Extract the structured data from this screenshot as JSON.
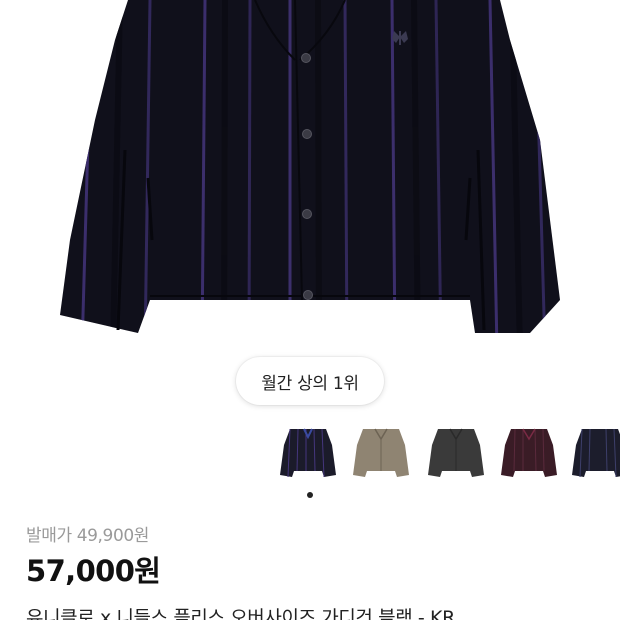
{
  "product": {
    "rank_badge": "월간 상의 1위",
    "original_price": "발매가 49,900원",
    "price": "57,000원",
    "title": "유니클로 x 니들스 플리스 오버사이즈 가디건 블랙 - KR"
  },
  "colors": {
    "jacket_base": "#13131f",
    "stripe_purple": "#4b3a86",
    "stripe_dark": "#0a0a12",
    "button": "#3a3a44",
    "variant_1": "#1b1b2a",
    "variant_2": "#8f8472",
    "variant_3": "#3a3a3a",
    "variant_4": "#3a1c26",
    "variant_5": "#1c1d2c"
  },
  "icons": {
    "butterfly_logo": "butterfly-logo-icon",
    "carousel_indicator": "carousel-dot-icon"
  },
  "gallery": {
    "selected_index": 0,
    "variant_count": 5
  }
}
